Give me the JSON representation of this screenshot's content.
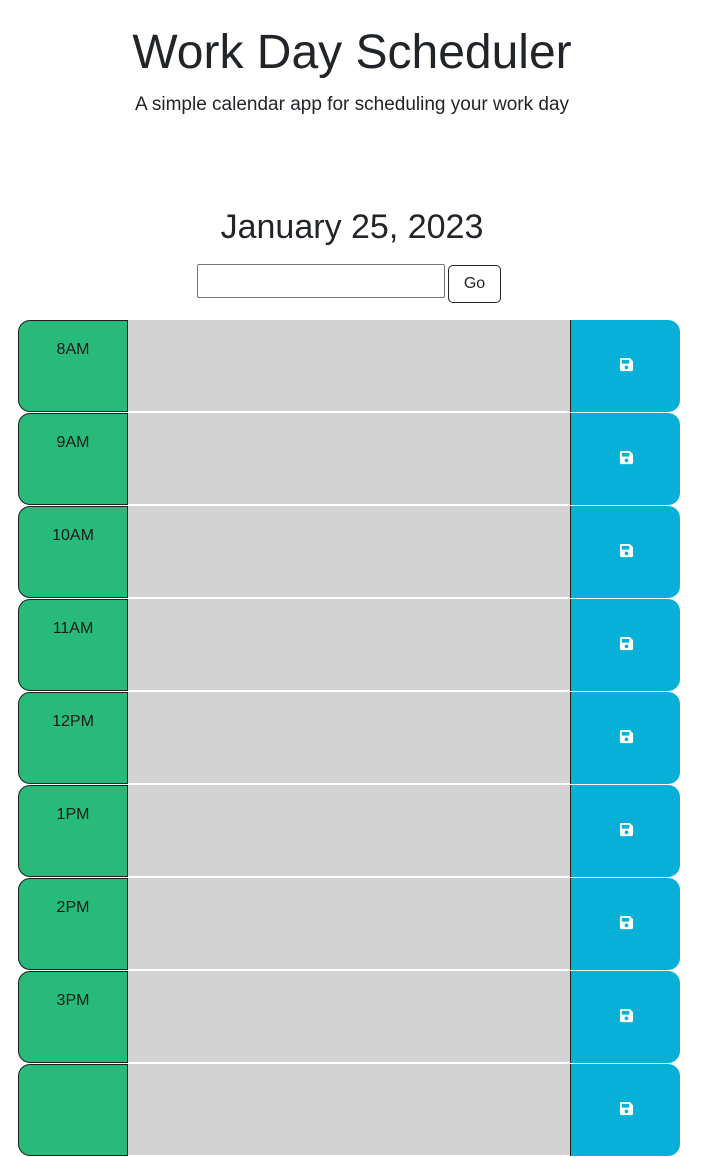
{
  "header": {
    "title": "Work Day Scheduler",
    "subtitle": "A simple calendar app for scheduling your work day"
  },
  "current_date": "January 25, 2023",
  "date_picker": {
    "value": "",
    "go_label": "Go"
  },
  "timeblocks": [
    {
      "hour": "8AM",
      "description": "",
      "state": "future"
    },
    {
      "hour": "9AM",
      "description": "",
      "state": "future"
    },
    {
      "hour": "10AM",
      "description": "",
      "state": "future"
    },
    {
      "hour": "11AM",
      "description": "",
      "state": "future"
    },
    {
      "hour": "12PM",
      "description": "",
      "state": "future"
    },
    {
      "hour": "1PM",
      "description": "",
      "state": "future"
    },
    {
      "hour": "2PM",
      "description": "",
      "state": "future"
    },
    {
      "hour": "3PM",
      "description": "",
      "state": "future"
    },
    {
      "hour": "",
      "description": "",
      "state": "future"
    }
  ],
  "colors": {
    "hour_block": "#27ba7a",
    "description_bg": "#d3d3d3",
    "save_button": "#06b0d6"
  },
  "icons": {
    "save": "floppy-disk-icon"
  }
}
